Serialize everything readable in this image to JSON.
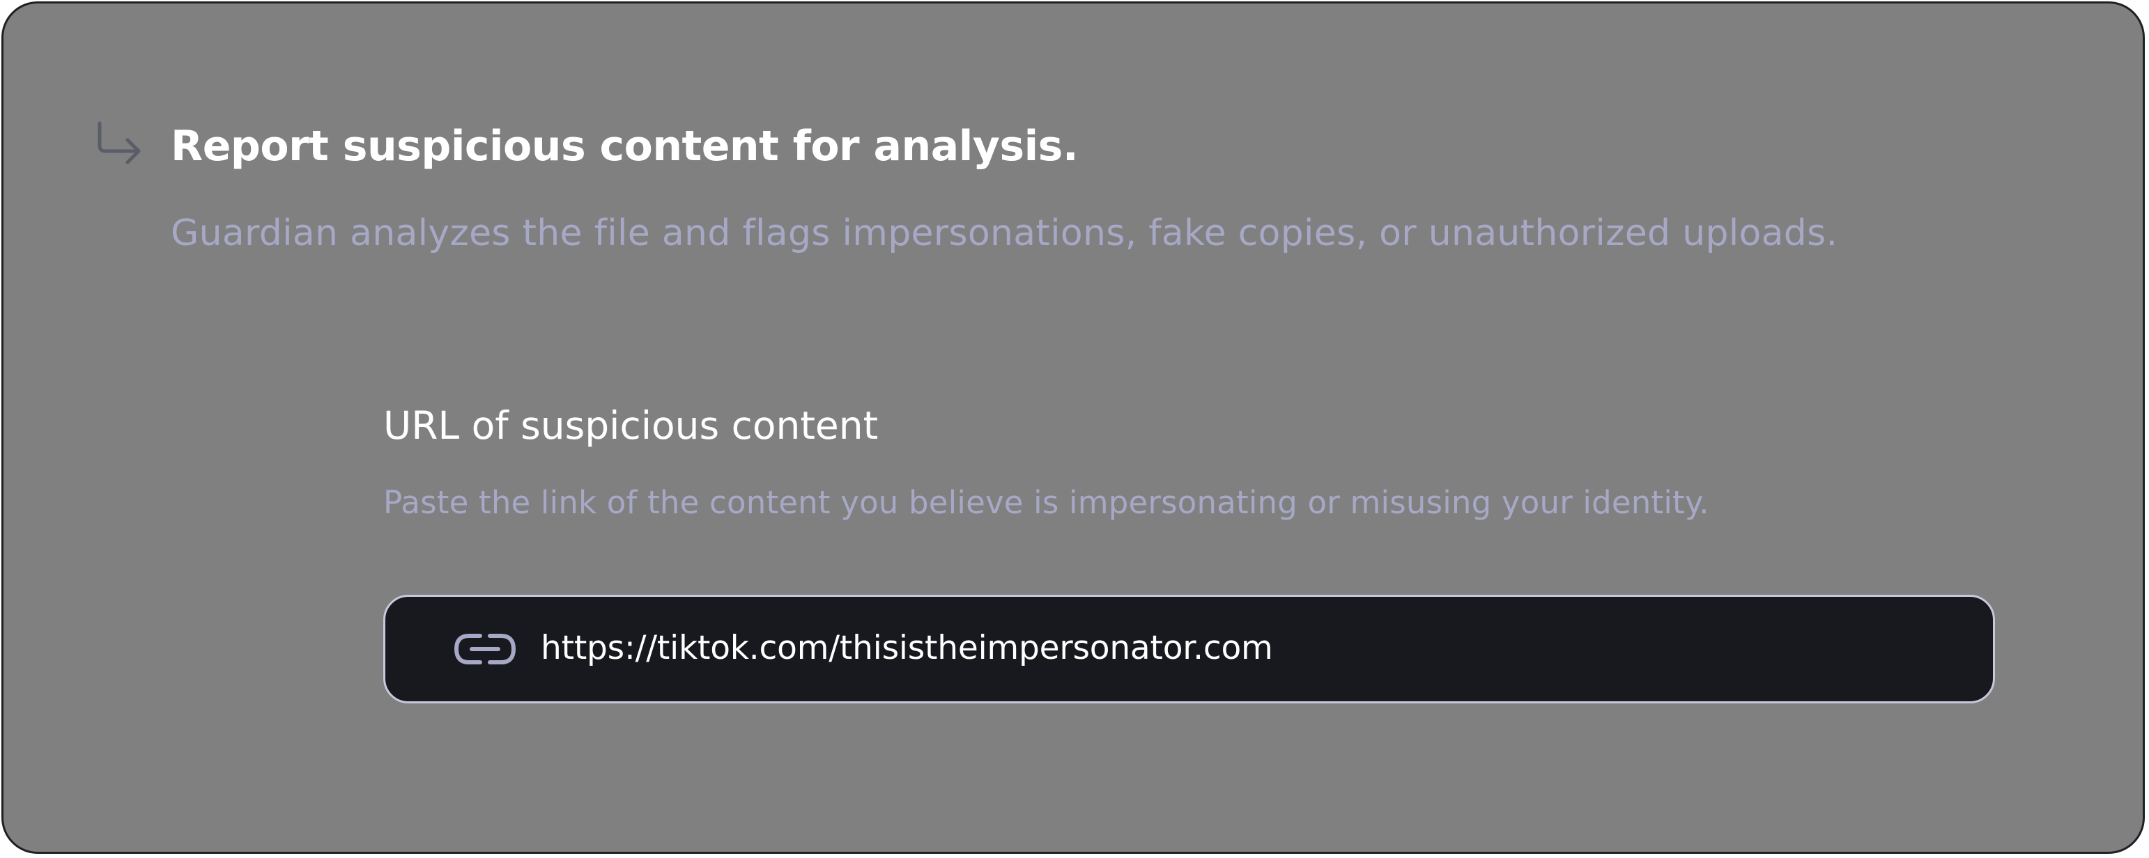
{
  "header": {
    "icon": "return-arrow-icon",
    "title": "Report suspicious content for analysis.",
    "subtitle": "Guardian analyzes the file and flags impersonations, fake copies, or unauthorized uploads."
  },
  "url_field": {
    "label": "URL of suspicious content",
    "help_text": "Paste the link of the content you believe is impersonating or misusing your identity.",
    "icon": "link-icon",
    "value": "https://tiktok.com/thisistheimpersonator.com"
  },
  "colors": {
    "card_background": "#808080",
    "card_border": "#1f2025",
    "title_text": "#ffffff",
    "muted_text": "#a7a8c6",
    "input_background": "#18191e",
    "input_border": "#c6c8dc",
    "icon_muted": "#5a5c68",
    "link_icon": "#a7a8c6"
  }
}
